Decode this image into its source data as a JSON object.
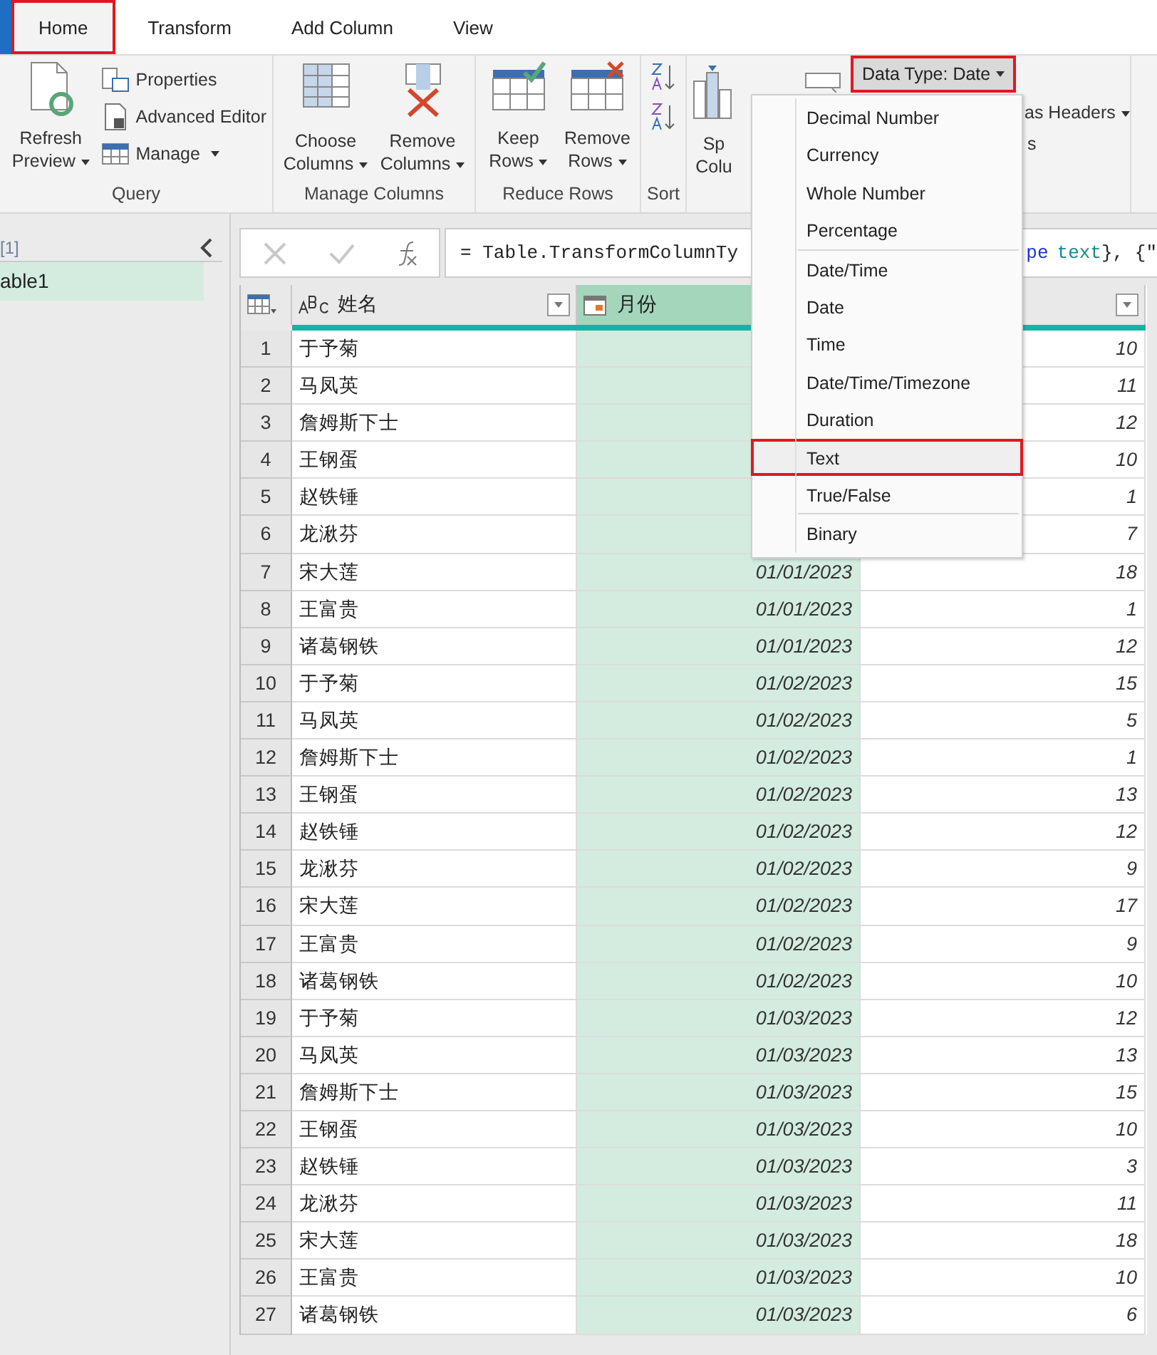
{
  "tabs": [
    {
      "label": "Home",
      "selected": true,
      "highlighted": true
    },
    {
      "label": "Transform",
      "selected": false,
      "highlighted": false
    },
    {
      "label": "Add Column",
      "selected": false,
      "highlighted": false
    },
    {
      "label": "View",
      "selected": false,
      "highlighted": false
    }
  ],
  "ribbon": {
    "groups": [
      {
        "label": "Query",
        "kind": "query",
        "big": {
          "lines": [
            "Refresh",
            "Preview"
          ],
          "dropdown": true
        },
        "small": [
          {
            "label": "Properties",
            "dropdown": false
          },
          {
            "label": "Advanced Editor",
            "dropdown": false
          },
          {
            "label": "Manage",
            "dropdown": true
          }
        ]
      },
      {
        "label": "Manage Columns",
        "kind": "buttons",
        "buttons": [
          {
            "lines": [
              "Choose",
              "Columns"
            ],
            "dropdown": true
          },
          {
            "lines": [
              "Remove",
              "Columns"
            ],
            "dropdown": true
          }
        ]
      },
      {
        "label": "Reduce Rows",
        "kind": "buttons",
        "buttons": [
          {
            "lines": [
              "Keep",
              "Rows"
            ],
            "dropdown": true
          },
          {
            "lines": [
              "Remove",
              "Rows"
            ],
            "dropdown": true
          }
        ]
      },
      {
        "label": "Sort",
        "kind": "sort"
      },
      {
        "kind": "transform",
        "split": [
          "Sp",
          "Colu"
        ],
        "data_type": {
          "label": "Data Type: Date",
          "highlighted": true
        },
        "headers": "as Headers",
        "replace": "s"
      }
    ]
  },
  "sidebar": {
    "group": "[1]",
    "items": [
      {
        "label": "able1",
        "selected": true
      }
    ]
  },
  "formula": {
    "start": "= Table.TransformColumnTy",
    "tail": [
      {
        "text": "pe",
        "kind": "keyword"
      },
      {
        "text": "text",
        "kind": "type"
      },
      {
        "text": "}, {\"",
        "kind": "plain"
      }
    ]
  },
  "columns": [
    {
      "label": "姓名",
      "kind": "text",
      "selected": false
    },
    {
      "label": "月份",
      "kind": "date",
      "selected": true
    },
    {
      "kind": "number",
      "selected": false
    }
  ],
  "rows": [
    {
      "num": "1",
      "name": "于予菊",
      "value": "10"
    },
    {
      "num": "2",
      "name": "马凤英",
      "value": "11"
    },
    {
      "num": "3",
      "name": "詹姆斯下士",
      "value": "12"
    },
    {
      "num": "4",
      "name": "王钢蛋",
      "value": "10"
    },
    {
      "num": "5",
      "name": "赵铁锤",
      "value": "1"
    },
    {
      "num": "6",
      "name": "龙湫芬",
      "value": "7"
    },
    {
      "num": "7",
      "name": "宋大莲",
      "month": "01/01/2023",
      "value": "18"
    },
    {
      "num": "8",
      "name": "王富贵",
      "month": "01/01/2023",
      "value": "1"
    },
    {
      "num": "9",
      "name": "诸葛钢铁",
      "month": "01/01/2023",
      "value": "12"
    },
    {
      "num": "10",
      "name": "于予菊",
      "month": "01/02/2023",
      "value": "15"
    },
    {
      "num": "11",
      "name": "马凤英",
      "month": "01/02/2023",
      "value": "5"
    },
    {
      "num": "12",
      "name": "詹姆斯下士",
      "month": "01/02/2023",
      "value": "1"
    },
    {
      "num": "13",
      "name": "王钢蛋",
      "month": "01/02/2023",
      "value": "13"
    },
    {
      "num": "14",
      "name": "赵铁锤",
      "month": "01/02/2023",
      "value": "12"
    },
    {
      "num": "15",
      "name": "龙湫芬",
      "month": "01/02/2023",
      "value": "9"
    },
    {
      "num": "16",
      "name": "宋大莲",
      "month": "01/02/2023",
      "value": "17"
    },
    {
      "num": "17",
      "name": "王富贵",
      "month": "01/02/2023",
      "value": "9"
    },
    {
      "num": "18",
      "name": "诸葛钢铁",
      "month": "01/02/2023",
      "value": "10"
    },
    {
      "num": "19",
      "name": "于予菊",
      "month": "01/03/2023",
      "value": "12"
    },
    {
      "num": "20",
      "name": "马凤英",
      "month": "01/03/2023",
      "value": "13"
    },
    {
      "num": "21",
      "name": "詹姆斯下士",
      "month": "01/03/2023",
      "value": "15"
    },
    {
      "num": "22",
      "name": "王钢蛋",
      "month": "01/03/2023",
      "value": "10"
    },
    {
      "num": "23",
      "name": "赵铁锤",
      "month": "01/03/2023",
      "value": "3"
    },
    {
      "num": "24",
      "name": "龙湫芬",
      "month": "01/03/2023",
      "value": "11"
    },
    {
      "num": "25",
      "name": "宋大莲",
      "month": "01/03/2023",
      "value": "18"
    },
    {
      "num": "26",
      "name": "王富贵",
      "month": "01/03/2023",
      "value": "10"
    },
    {
      "num": "27",
      "name": "诸葛钢铁",
      "month": "01/03/2023",
      "value": "6"
    }
  ],
  "type_menu": {
    "items": [
      {
        "label": "Decimal Number",
        "separator_before": false,
        "highlighted": false
      },
      {
        "label": "Currency",
        "separator_before": false,
        "highlighted": false
      },
      {
        "label": "Whole Number",
        "separator_before": false,
        "highlighted": false
      },
      {
        "label": "Percentage",
        "separator_before": false,
        "highlighted": false
      },
      {
        "label": "Date/Time",
        "separator_before": true,
        "highlighted": false
      },
      {
        "label": "Date",
        "separator_before": false,
        "highlighted": false
      },
      {
        "label": "Time",
        "separator_before": false,
        "highlighted": false
      },
      {
        "label": "Date/Time/Timezone",
        "separator_before": false,
        "highlighted": false
      },
      {
        "label": "Duration",
        "separator_before": false,
        "highlighted": false
      },
      {
        "label": "Text",
        "separator_before": false,
        "highlighted": true
      },
      {
        "label": "True/False",
        "separator_before": false,
        "highlighted": false
      },
      {
        "label": "Binary",
        "separator_before": true,
        "highlighted": false
      }
    ]
  }
}
